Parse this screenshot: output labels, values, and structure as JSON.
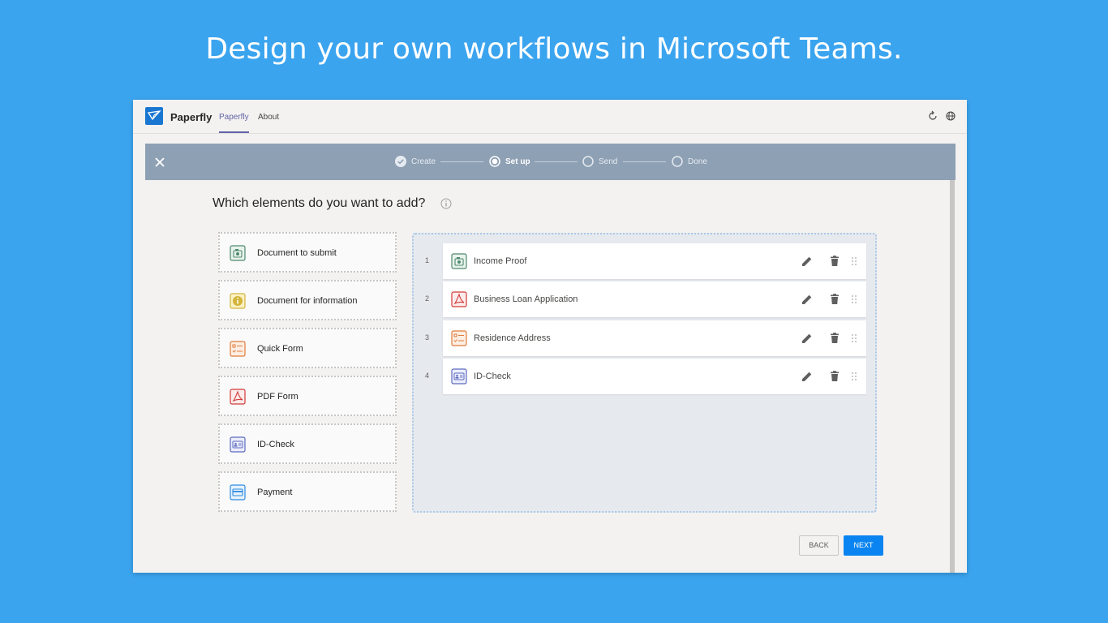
{
  "headline": "Design your own workflows in Microsoft Teams.",
  "app": {
    "name": "Paperfly",
    "tabs": [
      {
        "label": "Paperfly",
        "active": true
      },
      {
        "label": "About",
        "active": false
      }
    ],
    "accent_color": "#6264a7"
  },
  "stepper": {
    "steps": [
      {
        "label": "Create",
        "state": "done"
      },
      {
        "label": "Set up",
        "state": "current"
      },
      {
        "label": "Send",
        "state": "pending"
      },
      {
        "label": "Done",
        "state": "pending"
      }
    ]
  },
  "main": {
    "question": "Which elements do you want to add?",
    "palette": [
      {
        "label": "Document to submit",
        "icon": "document-submit-icon"
      },
      {
        "label": "Document for information",
        "icon": "info-document-icon"
      },
      {
        "label": "Quick Form",
        "icon": "quick-form-icon"
      },
      {
        "label": "PDF Form",
        "icon": "pdf-icon"
      },
      {
        "label": "ID-Check",
        "icon": "id-card-icon"
      },
      {
        "label": "Payment",
        "icon": "credit-card-icon"
      }
    ],
    "selected": [
      {
        "num": "1",
        "label": "Income Proof",
        "icon": "document-submit-icon"
      },
      {
        "num": "2",
        "label": "Business Loan Application",
        "icon": "pdf-icon"
      },
      {
        "num": "3",
        "label": "Residence Address",
        "icon": "quick-form-icon"
      },
      {
        "num": "4",
        "label": "ID-Check",
        "icon": "id-card-icon"
      }
    ],
    "back_label": "BACK",
    "next_label": "NEXT"
  }
}
